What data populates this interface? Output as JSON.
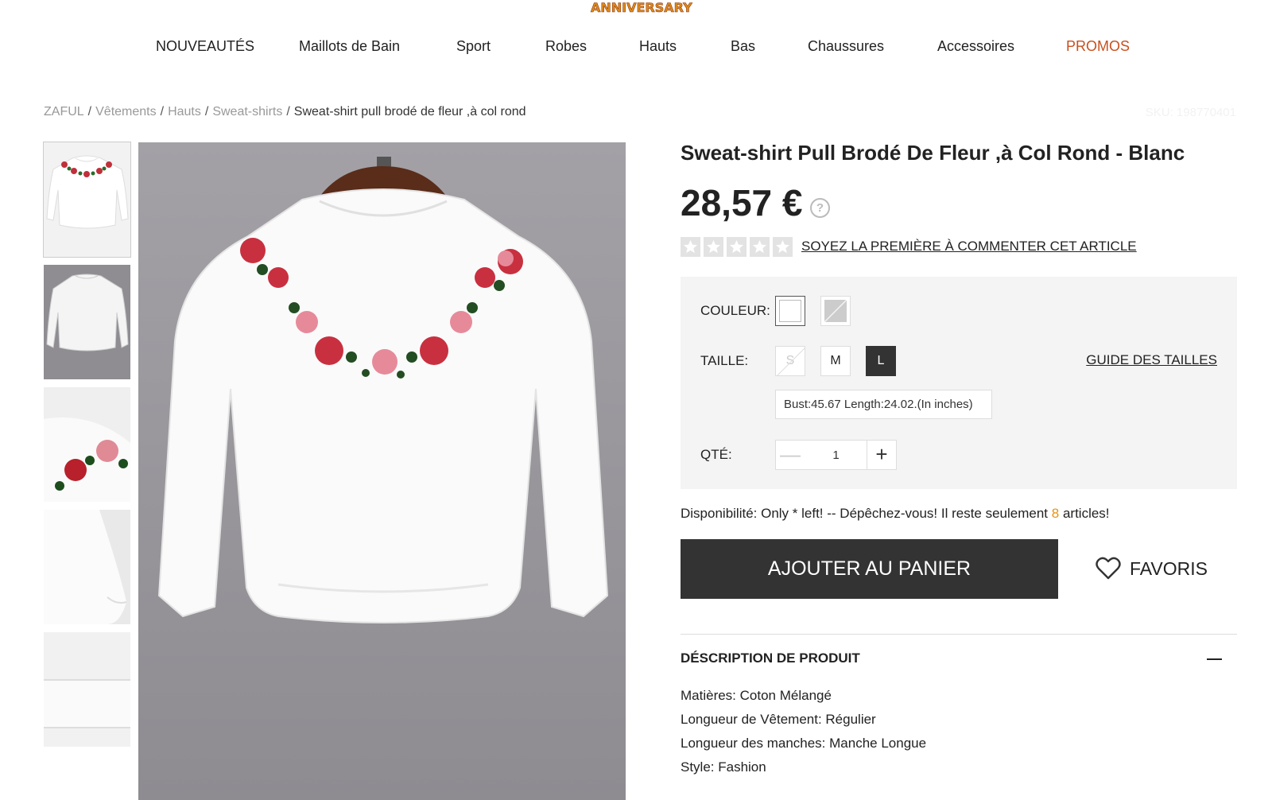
{
  "header": {
    "logo_text": "ANNIVERSARY"
  },
  "nav": {
    "items": [
      "NOUVEAUTÉS",
      "Maillots de Bain",
      "Sport",
      "Robes",
      "Hauts",
      "Bas",
      "Chaussures",
      "Accessoires",
      "PROMOS"
    ],
    "accent_color": "#c8501e"
  },
  "breadcrumb": {
    "items": [
      "ZAFUL",
      "Vêtements",
      "Hauts",
      "Sweat-shirts"
    ],
    "current": "Sweat-shirt pull brodé de fleur ,à col rond",
    "separator": "/"
  },
  "sku": "SKU: 198770401",
  "gallery": {
    "thumbnails": [
      "front-view",
      "back-view",
      "sleeve-detail",
      "cuff-detail",
      "hem-detail"
    ],
    "active_index": 0
  },
  "product": {
    "title": "Sweat-shirt Pull Brodé De Fleur ,à Col Rond - Blanc",
    "price": "28,57 €",
    "rating": 0,
    "review_link": "SOYEZ LA PREMIÈRE À COMMENTER CET ARTICLE"
  },
  "options": {
    "color_label": "COULEUR:",
    "colors": [
      {
        "name": "Blanc",
        "hex": "#ffffff",
        "selected": true
      },
      {
        "name": "Gris",
        "hex": "#cccccc",
        "selected": false
      }
    ],
    "size_label": "TAILLE:",
    "sizes": [
      {
        "label": "S",
        "available": false,
        "selected": false
      },
      {
        "label": "M",
        "available": true,
        "selected": false
      },
      {
        "label": "L",
        "available": true,
        "selected": true
      }
    ],
    "size_guide": "GUIDE DES TAILLES",
    "measurements": "Bust:45.67   Length:24.02.(In inches)",
    "qty_label": "QTÉ:",
    "qty_value": "1",
    "qty_minus": "—",
    "qty_plus": "+"
  },
  "availability": {
    "before": "Disponibilité: Only * left! -- Dépêchez-vous! Il reste seulement ",
    "count": "8",
    "after": " articles!",
    "count_color": "#e8920c"
  },
  "actions": {
    "add_to_cart": "AJOUTER AU PANIER",
    "favorites": "FAVORIS"
  },
  "description": {
    "header": "DÉSCRIPTION DE PRODUIT",
    "lines": [
      "Matières: Coton Mélangé",
      "Longueur de Vêtement: Régulier",
      "Longueur des manches: Manche Longue",
      "Style: Fashion"
    ]
  }
}
